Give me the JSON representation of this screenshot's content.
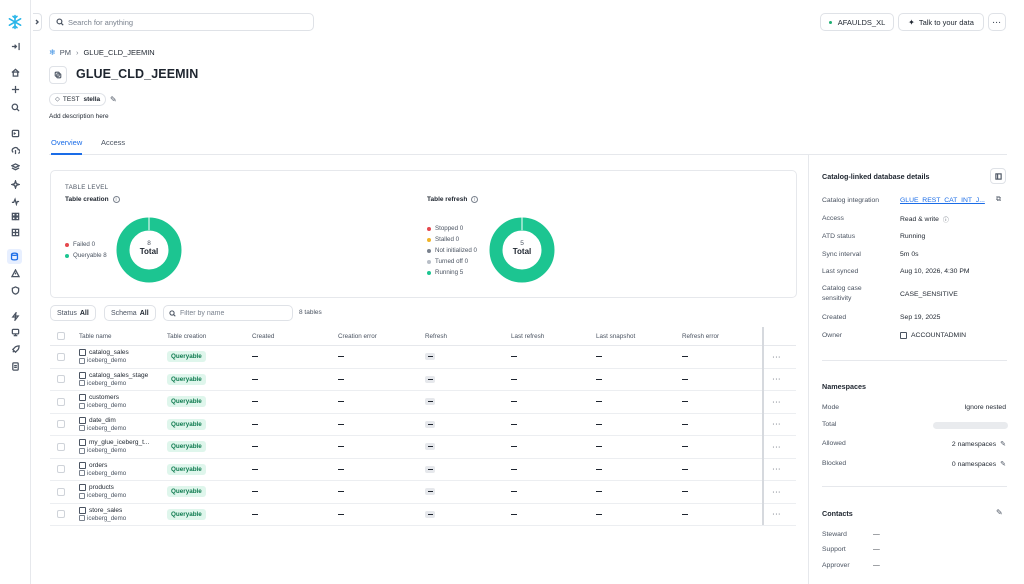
{
  "search": {
    "placeholder": "Search for anything"
  },
  "topbar": {
    "warehouse": "AFAULDS_XL",
    "talk": "Talk to your data",
    "more": "···"
  },
  "breadcrumb": {
    "parent": "PM",
    "separator": "›",
    "current": "GLUE_CLD_JEEMIN"
  },
  "page": {
    "title": "GLUE_CLD_JEEMIN",
    "tag_key": "TEST",
    "tag_value": "stella",
    "description": "Add description here",
    "tabs": [
      "Overview",
      "Access"
    ]
  },
  "summary": {
    "section_label": "TABLE LEVEL",
    "creation": {
      "title": "Table creation",
      "legend": [
        {
          "label": "Failed 0",
          "color": "#e5484d"
        },
        {
          "label": "Queryable 8",
          "color": "#1cc591"
        }
      ],
      "total_value": "8",
      "total_label": "Total"
    },
    "refresh": {
      "title": "Table refresh",
      "legend": [
        {
          "label": "Stopped 0",
          "color": "#e5484d"
        },
        {
          "label": "Stalled 0",
          "color": "#f0b429"
        },
        {
          "label": "Not initialized 0",
          "color": "#7a828e"
        },
        {
          "label": "Turned off 0",
          "color": "#b8bec7"
        },
        {
          "label": "Running 5",
          "color": "#1cc591"
        }
      ],
      "total_value": "5",
      "total_label": "Total"
    }
  },
  "filters": {
    "status_label": "Status",
    "status_value": "All",
    "schema_label": "Schema",
    "schema_value": "All",
    "name_placeholder": "Filter by name",
    "count": "8 tables"
  },
  "table": {
    "columns": [
      "Table name",
      "Table creation",
      "Created",
      "Creation error",
      "Refresh",
      "Last refresh",
      "Last snapshot",
      "Refresh error"
    ],
    "rows": [
      {
        "name": "catalog_sales",
        "schema": "iceberg_demo",
        "creation": "Queryable"
      },
      {
        "name": "catalog_sales_stage",
        "schema": "iceberg_demo",
        "creation": "Queryable"
      },
      {
        "name": "customers",
        "schema": "iceberg_demo",
        "creation": "Queryable"
      },
      {
        "name": "date_dim",
        "schema": "iceberg_demo",
        "creation": "Queryable"
      },
      {
        "name": "my_glue_iceberg_t...",
        "schema": "iceberg_demo",
        "creation": "Queryable"
      },
      {
        "name": "orders",
        "schema": "iceberg_demo",
        "creation": "Queryable"
      },
      {
        "name": "products",
        "schema": "iceberg_demo",
        "creation": "Queryable"
      },
      {
        "name": "store_sales",
        "schema": "iceberg_demo",
        "creation": "Queryable"
      }
    ],
    "row_more": "···"
  },
  "details": {
    "title": "Catalog-linked database details",
    "items": [
      {
        "label": "Catalog integration",
        "value": "GLUE_REST_CAT_INT_J..."
      },
      {
        "label": "Access",
        "value": "Read & write"
      },
      {
        "label": "ATD status",
        "value": "Running"
      },
      {
        "label": "Sync interval",
        "value": "5m 0s"
      },
      {
        "label": "Last synced",
        "value": "Aug 10, 2026, 4:30 PM"
      },
      {
        "label": "Catalog case",
        "label2": "sensitivity",
        "value": "CASE_SENSITIVE"
      },
      {
        "label": "Created",
        "value": "Sep 19, 2025"
      },
      {
        "label": "Owner",
        "value": "ACCOUNTADMIN"
      }
    ]
  },
  "namespaces": {
    "title": "Namespaces",
    "mode_label": "Mode",
    "mode_value": "Ignore nested",
    "total_label": "Total",
    "allowed_label": "Allowed",
    "allowed_value": "2 namespaces",
    "blocked_label": "Blocked",
    "blocked_value": "0 namespaces"
  },
  "contacts": {
    "title": "Contacts",
    "steward_label": "Steward",
    "steward_value": "—",
    "support_label": "Support",
    "support_value": "—",
    "approver_label": "Approver",
    "approver_value": "—"
  },
  "colors": {
    "accent": "#1a6ce7",
    "queryable": "#1cc591",
    "brand": "#29b5e8"
  }
}
